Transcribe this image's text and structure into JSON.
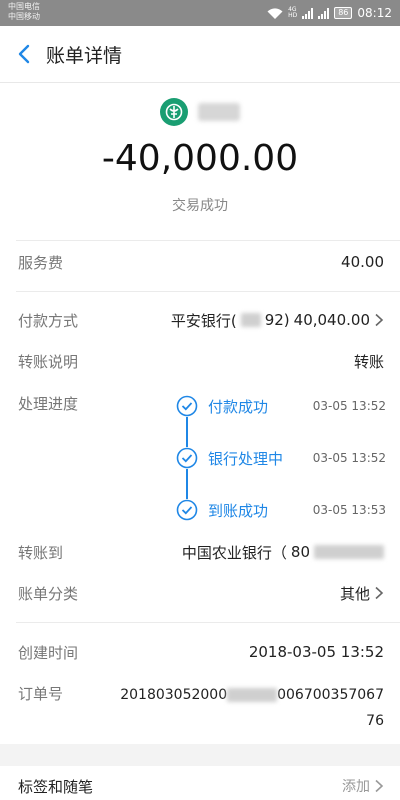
{
  "status_bar": {
    "carrier_1": "中国电信",
    "carrier_2": "中国移动",
    "net_1": "4G",
    "net_2": "HD",
    "battery": "86",
    "time": "08:12"
  },
  "header": {
    "title": "账单详情"
  },
  "payee": {
    "bank_icon": "agricultural-bank-logo",
    "amount": "-40,000.00",
    "status": "交易成功"
  },
  "rows": {
    "service_fee": {
      "label": "服务费",
      "value": "40.00"
    },
    "payment_method": {
      "label": "付款方式",
      "bank_prefix": "平安银行(",
      "bank_suffix": "92)",
      "value": "40,040.00"
    },
    "transfer_note": {
      "label": "转账说明",
      "value": "转账"
    },
    "progress": {
      "label": "处理进度",
      "steps": [
        {
          "text": "付款成功",
          "time": "03-05 13:52"
        },
        {
          "text": "银行处理中",
          "time": "03-05 13:52"
        },
        {
          "text": "到账成功",
          "time": "03-05 13:53"
        }
      ]
    },
    "transfer_to": {
      "label": "转账到",
      "value_prefix": "中国农业银行（",
      "value_partial": "80"
    },
    "category": {
      "label": "账单分类",
      "value": "其他"
    },
    "created_time": {
      "label": "创建时间",
      "value": "2018-03-05 13:52"
    },
    "order_no": {
      "label": "订单号",
      "value_start": "201803052000",
      "value_end": "006700357067",
      "value_tail": "76"
    }
  },
  "tags": {
    "label": "标签和随笔",
    "action": "添加"
  },
  "colors": {
    "accent": "#1f87e6",
    "bank_green": "#1a9e72"
  }
}
